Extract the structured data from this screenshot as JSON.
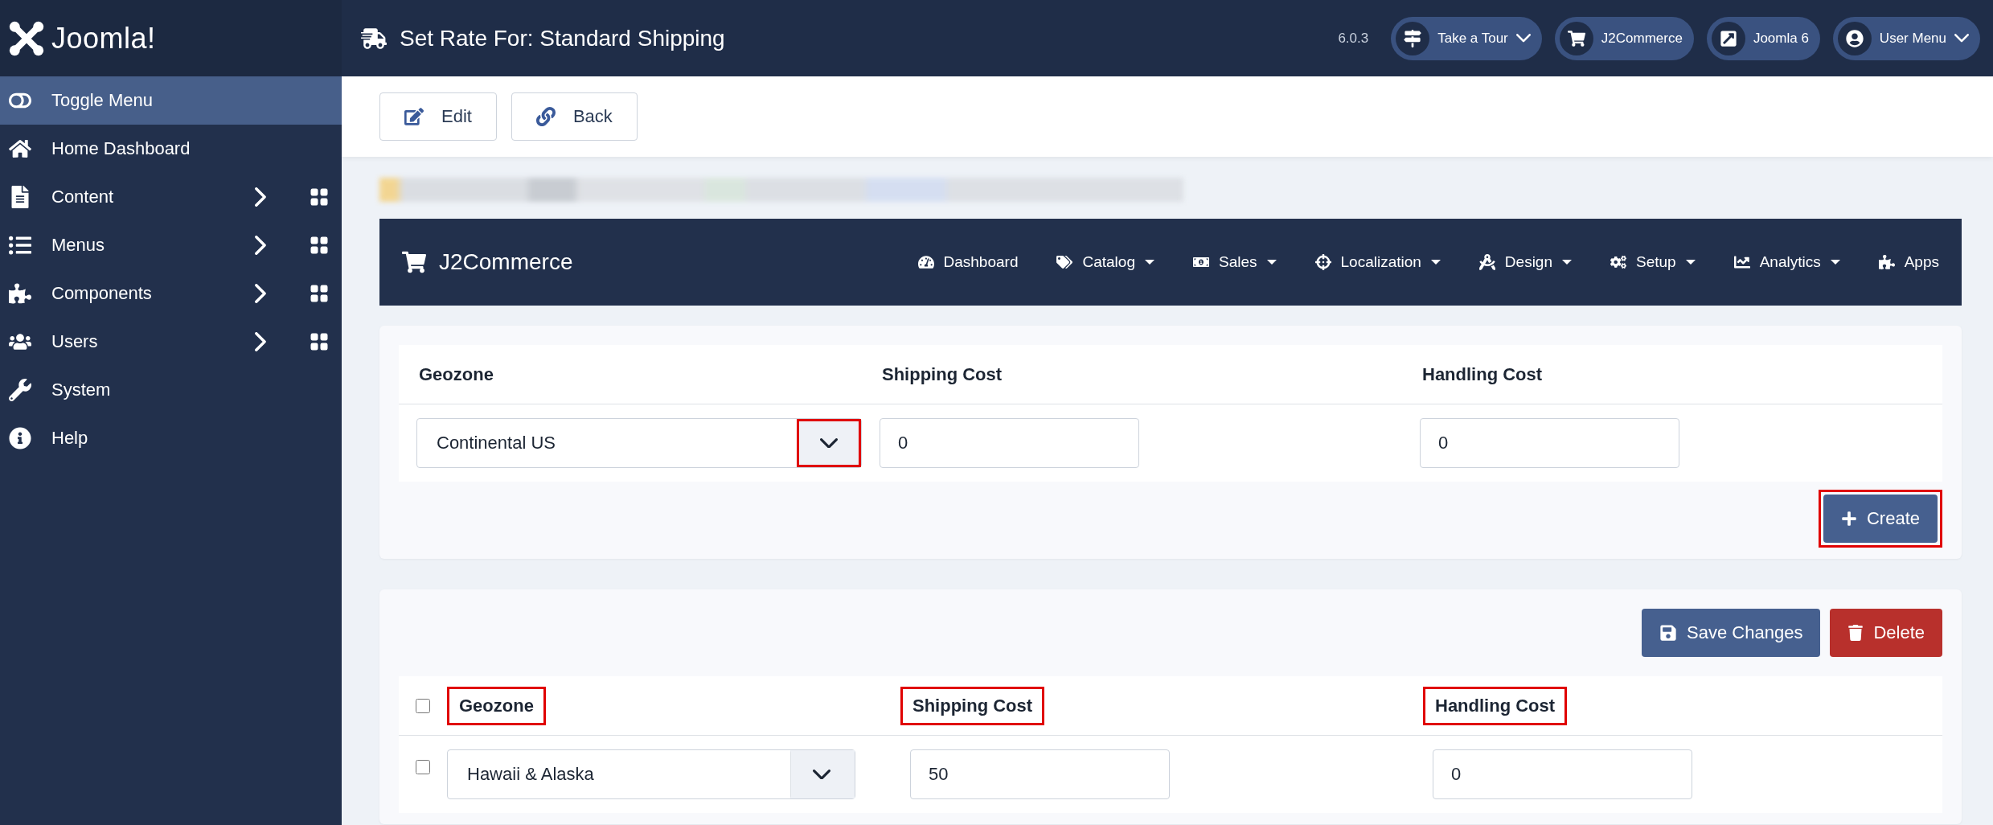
{
  "logo": {
    "text": "Joomla!"
  },
  "header": {
    "title": "Set Rate For: Standard Shipping",
    "version": "6.0.3",
    "buttons": [
      {
        "label": "Take a Tour",
        "dropdown": true
      },
      {
        "label": "J2Commerce",
        "dropdown": false
      },
      {
        "label": "Joomla 6",
        "dropdown": false
      },
      {
        "label": "User Menu",
        "dropdown": true
      }
    ]
  },
  "sidebar": {
    "items": [
      {
        "label": "Toggle Menu",
        "selected": true,
        "expandable": false
      },
      {
        "label": "Home Dashboard",
        "selected": false,
        "expandable": false
      },
      {
        "label": "Content",
        "selected": false,
        "expandable": true
      },
      {
        "label": "Menus",
        "selected": false,
        "expandable": true
      },
      {
        "label": "Components",
        "selected": false,
        "expandable": true
      },
      {
        "label": "Users",
        "selected": false,
        "expandable": true
      },
      {
        "label": "System",
        "selected": false,
        "expandable": false
      },
      {
        "label": "Help",
        "selected": false,
        "expandable": false
      }
    ]
  },
  "toolbar": {
    "buttons": [
      "Edit",
      "Back"
    ]
  },
  "j2_nav": {
    "brand": "J2Commerce",
    "items": [
      {
        "label": "Dashboard",
        "dropdown": false
      },
      {
        "label": "Catalog",
        "dropdown": true
      },
      {
        "label": "Sales",
        "dropdown": true
      },
      {
        "label": "Localization",
        "dropdown": true
      },
      {
        "label": "Design",
        "dropdown": true
      },
      {
        "label": "Setup",
        "dropdown": true
      },
      {
        "label": "Analytics",
        "dropdown": true
      },
      {
        "label": "Apps",
        "dropdown": false
      }
    ]
  },
  "new_rate": {
    "columns": [
      {
        "label": "Geozone",
        "highlighted": false
      },
      {
        "label": "Shipping Cost",
        "highlighted": false
      },
      {
        "label": "Handling Cost",
        "highlighted": false
      }
    ],
    "geozone": {
      "value": "Continental US",
      "toggle_highlighted": true
    },
    "shipping_cost": "0",
    "handling_cost": "0",
    "create_button": {
      "label": "Create",
      "highlighted": true
    }
  },
  "rates": {
    "save_label": "Save Changes",
    "delete_label": "Delete",
    "all_checked": false,
    "columns": [
      {
        "label": "Geozone",
        "highlighted": true
      },
      {
        "label": "Shipping Cost",
        "highlighted": true
      },
      {
        "label": "Handling Cost",
        "highlighted": true
      }
    ],
    "rows": [
      {
        "checked": false,
        "geozone": "Hawaii & Alaska",
        "toggle_highlighted": false,
        "shipping_cost": "50",
        "handling_cost": "0"
      }
    ]
  }
}
